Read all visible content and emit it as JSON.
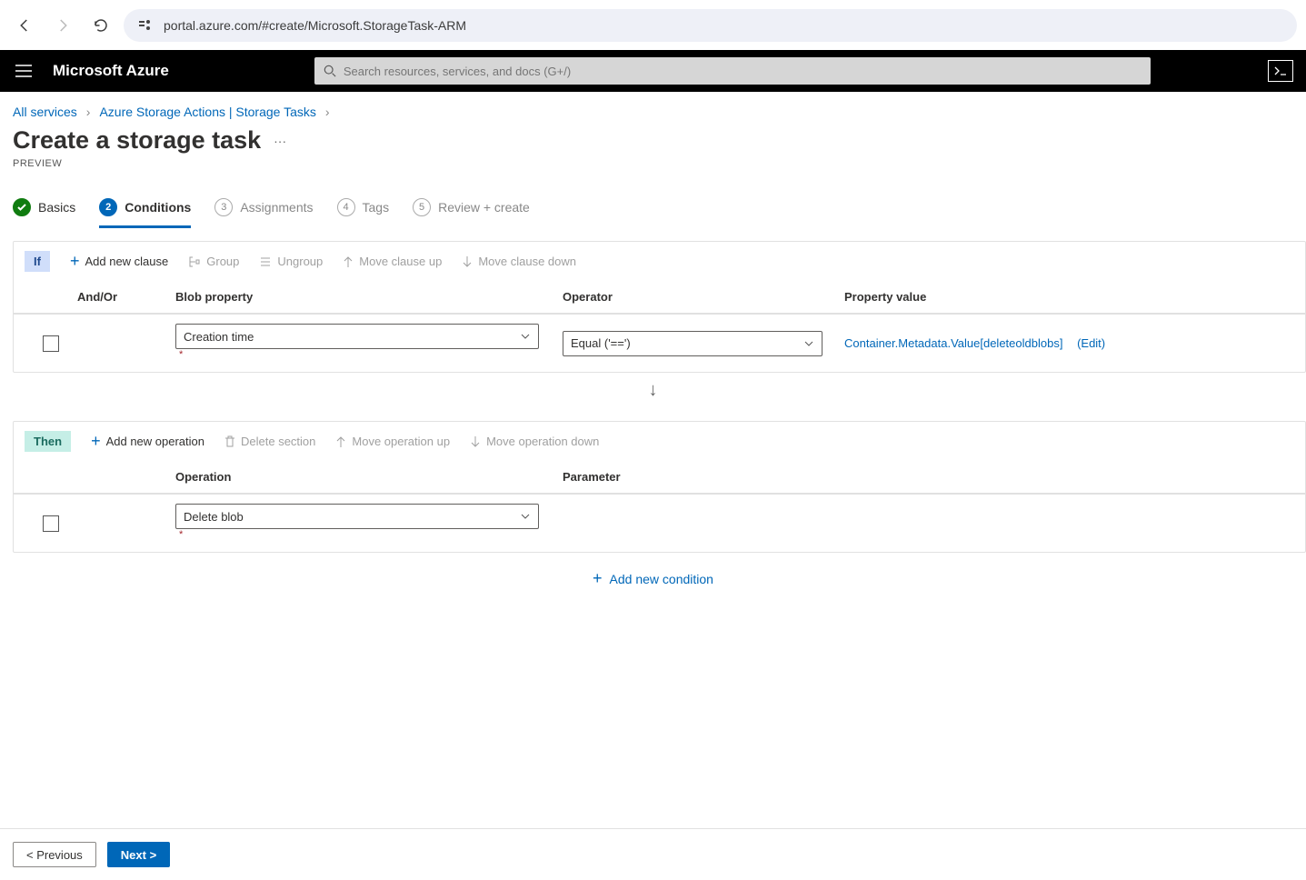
{
  "browser": {
    "url": "portal.azure.com/#create/Microsoft.StorageTask-ARM"
  },
  "azure": {
    "logo": "Microsoft Azure",
    "search_placeholder": "Search resources, services, and docs (G+/)"
  },
  "breadcrumb": {
    "all_services": "All services",
    "storage_actions": "Azure Storage Actions | Storage Tasks"
  },
  "page": {
    "title": "Create a storage task",
    "preview": "PREVIEW"
  },
  "tabs": {
    "basics": "Basics",
    "conditions": "Conditions",
    "assignments": "Assignments",
    "tags": "Tags",
    "review": "Review + create",
    "n2": "2",
    "n3": "3",
    "n4": "4",
    "n5": "5"
  },
  "ifblock": {
    "tag": "If",
    "add_clause": "Add new clause",
    "group": "Group",
    "ungroup": "Ungroup",
    "move_up": "Move clause up",
    "move_down": "Move clause down",
    "col_andor": "And/Or",
    "col_prop": "Blob property",
    "col_op": "Operator",
    "col_val": "Property value",
    "row1": {
      "prop": "Creation time",
      "op": "Equal ('==')",
      "val": "Container.Metadata.Value[deleteoldblobs]",
      "edit": "(Edit)"
    }
  },
  "thenblock": {
    "tag": "Then",
    "add_op": "Add new operation",
    "delete_sec": "Delete section",
    "move_up": "Move operation up",
    "move_down": "Move operation down",
    "col_op": "Operation",
    "col_param": "Parameter",
    "row1": {
      "op": "Delete blob"
    }
  },
  "add_condition": "Add new condition",
  "footer": {
    "previous": "< Previous",
    "next": "Next >"
  }
}
